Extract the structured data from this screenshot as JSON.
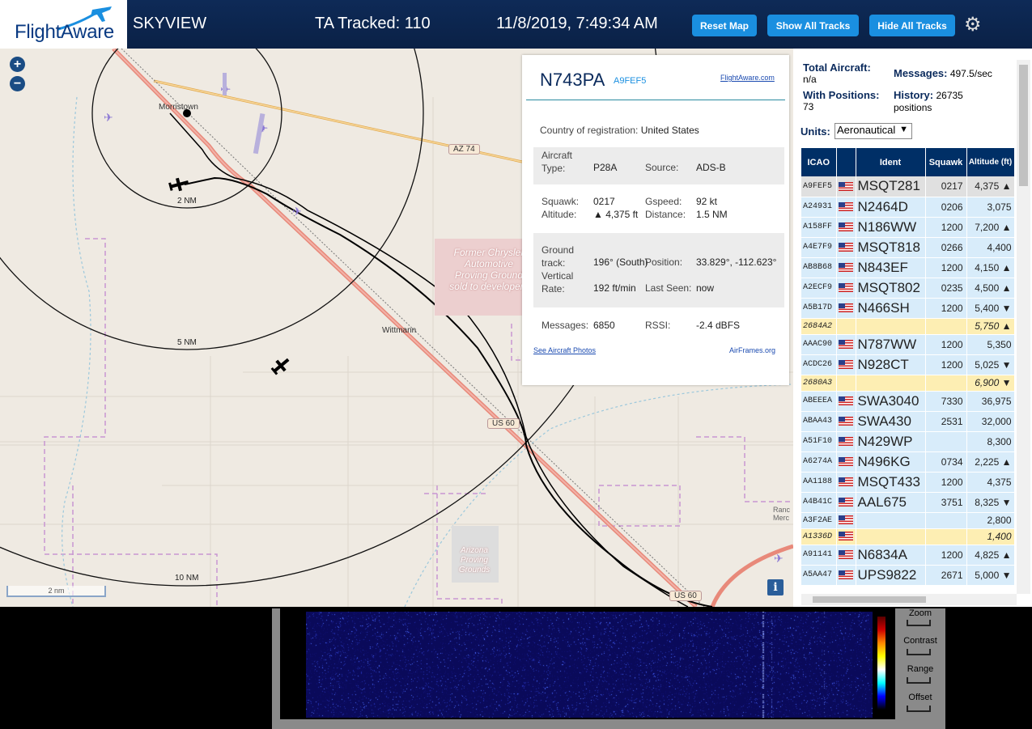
{
  "header": {
    "logo_text": "FlightAware",
    "app_title": "SKYVIEW",
    "ta_tracked": "TA Tracked: 110",
    "timestamp": "11/8/2019, 7:49:34 AM",
    "buttons": {
      "reset": "Reset Map",
      "show_all": "Show All Tracks",
      "hide_all": "Hide All Tracks"
    },
    "settings_icon": "gear-icon"
  },
  "map": {
    "zoom_in": "+",
    "zoom_out": "−",
    "places": {
      "morristown": "Morristown",
      "wittmann": "Wittmann"
    },
    "range_rings": {
      "r2": "2 NM",
      "r5": "5 NM",
      "r10": "10 NM"
    },
    "roads": {
      "az74": "AZ 74",
      "us60a": "US 60",
      "us60b": "US 60"
    },
    "areas": {
      "chrysler": "Former Chrysler Automotive Proving Ground sold to developers",
      "arizona": "Arizona Proving Grounds",
      "rancho": "Ranc Merc"
    },
    "scale": "2 nm",
    "info": "i"
  },
  "popup": {
    "registration": "N743PA",
    "hex": "A9FEF5",
    "fa_link": "FlightAware.com",
    "country_label": "Country of registration:",
    "country": "United States",
    "aircraft_type_label": "Aircraft Type:",
    "aircraft_type": "P28A",
    "source_label": "Source:",
    "source": "ADS-B",
    "squawk_label": "Squawk:",
    "squawk": "0217",
    "gspeed_label": "Gspeed:",
    "gspeed": "92 kt",
    "altitude_label": "Altitude:",
    "altitude": "▲ 4,375 ft",
    "distance_label": "Distance:",
    "distance": "1.5 NM",
    "ground_track_label": "Ground track:",
    "ground_track": "196° (South)",
    "position_label": "Position:",
    "position": "33.829°, -112.623°",
    "vertical_rate_label": "Vertical Rate:",
    "vertical_rate": "192 ft/min",
    "last_seen_label": "Last Seen:",
    "last_seen": "now",
    "messages_label": "Messages:",
    "messages": "6850",
    "rssi_label": "RSSI:",
    "rssi": "-2.4 dBFS",
    "photos_link": "See Aircraft Photos",
    "airframes_link": "AirFrames.org"
  },
  "stats": {
    "total_aircraft_label": "Total Aircraft:",
    "total_aircraft": "n/a",
    "messages_label": "Messages:",
    "messages": "497.5/sec",
    "with_positions_label": "With Positions:",
    "with_positions": "73",
    "history_label": "History:",
    "history": "26735 positions",
    "units_label": "Units:",
    "units_value": "Aeronautical"
  },
  "table": {
    "headers": {
      "icao": "ICAO",
      "ident": "Ident",
      "squawk": "Squawk",
      "altitude": "Altitude (ft)"
    },
    "rows": [
      {
        "icao": "A9FEF5",
        "ident": "MSQT281",
        "squawk": "0217",
        "alt": "4,375 ▲",
        "flag": true,
        "style": "sel"
      },
      {
        "icao": "A24931",
        "ident": "N2464D",
        "squawk": "0206",
        "alt": "3,075",
        "flag": true,
        "style": "r"
      },
      {
        "icao": "A158FF",
        "ident": "N186WW",
        "squawk": "1200",
        "alt": "7,200 ▲",
        "flag": true,
        "style": "r"
      },
      {
        "icao": "A4E7F9",
        "ident": "MSQT818",
        "squawk": "0266",
        "alt": "4,400",
        "flag": true,
        "style": "r"
      },
      {
        "icao": "AB8B68",
        "ident": "N843EF",
        "squawk": "1200",
        "alt": "4,150 ▲",
        "flag": true,
        "style": "r"
      },
      {
        "icao": "A2ECF9",
        "ident": "MSQT802",
        "squawk": "0235",
        "alt": "4,500 ▲",
        "flag": true,
        "style": "r"
      },
      {
        "icao": "A5B17D",
        "ident": "N466SH",
        "squawk": "1200",
        "alt": "5,400 ▼",
        "flag": true,
        "style": "r"
      },
      {
        "icao": "2684A2",
        "ident": "",
        "squawk": "",
        "alt": "5,750 ▲",
        "flag": false,
        "style": "y"
      },
      {
        "icao": "AAAC90",
        "ident": "N787WW",
        "squawk": "1200",
        "alt": "5,350",
        "flag": true,
        "style": "r"
      },
      {
        "icao": "ACDC26",
        "ident": "N928CT",
        "squawk": "1200",
        "alt": "5,025 ▼",
        "flag": true,
        "style": "r"
      },
      {
        "icao": "2680A3",
        "ident": "",
        "squawk": "",
        "alt": "6,900 ▼",
        "flag": false,
        "style": "y"
      },
      {
        "icao": "ABEEEA",
        "ident": "SWA3040",
        "squawk": "7330",
        "alt": "36,975",
        "flag": true,
        "style": "r"
      },
      {
        "icao": "ABAA43",
        "ident": "SWA430",
        "squawk": "2531",
        "alt": "32,000",
        "flag": true,
        "style": "r"
      },
      {
        "icao": "A51F10",
        "ident": "N429WP",
        "squawk": "",
        "alt": "8,300",
        "flag": true,
        "style": "r"
      },
      {
        "icao": "A6274A",
        "ident": "N496KG",
        "squawk": "0734",
        "alt": "2,225 ▲",
        "flag": true,
        "style": "r"
      },
      {
        "icao": "AA1188",
        "ident": "MSQT433",
        "squawk": "1200",
        "alt": "4,375",
        "flag": true,
        "style": "r"
      },
      {
        "icao": "A4B41C",
        "ident": "AAL675",
        "squawk": "3751",
        "alt": "8,325 ▼",
        "flag": true,
        "style": "r"
      },
      {
        "icao": "A3F2AE",
        "ident": "",
        "squawk": "",
        "alt": "2,800",
        "flag": true,
        "style": "r short"
      },
      {
        "icao": "A1336D",
        "ident": "",
        "squawk": "",
        "alt": "1,400",
        "flag": true,
        "style": "y short"
      },
      {
        "icao": "A91141",
        "ident": "N6834A",
        "squawk": "1200",
        "alt": "4,825 ▲",
        "flag": true,
        "style": "r"
      },
      {
        "icao": "A5AA47",
        "ident": "UPS9822",
        "squawk": "2671",
        "alt": "5,000 ▼",
        "flag": true,
        "style": "r"
      }
    ]
  },
  "waterfall": {
    "controls": {
      "zoom": "Zoom",
      "contrast": "Contrast",
      "range": "Range",
      "offset": "Offset"
    }
  },
  "colors": {
    "header_bg": "#0a2146",
    "button": "#1a8fe0",
    "table_header": "#002f66",
    "row_blue": "#d8ecfa",
    "row_yellow": "#fdeeb3"
  }
}
